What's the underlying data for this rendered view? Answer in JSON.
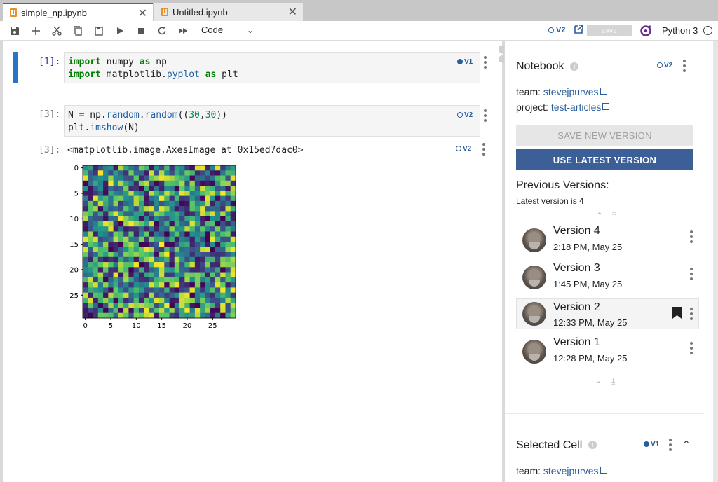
{
  "tabs": [
    {
      "label": "simple_np.ipynb",
      "active": true
    },
    {
      "label": "Untitled.ipynb",
      "active": false
    }
  ],
  "toolbar": {
    "cell_type": "Code",
    "version_tag": "V2",
    "save_label": "SAVE",
    "kernel_name": "Python 3"
  },
  "cells": [
    {
      "prompt": "[1]:",
      "version": "V1",
      "lines": [
        "import numpy as np",
        "import matplotlib.pyplot as plt"
      ]
    },
    {
      "prompt": "[3]:",
      "version": "V2",
      "lines": [
        "N = np.random.random((30,30))",
        "plt.imshow(N)"
      ]
    }
  ],
  "output": {
    "prompt": "[3]:",
    "version": "V2",
    "text": "<matplotlib.image.AxesImage at 0x15ed7dac0>"
  },
  "chart_data": {
    "type": "heatmap",
    "title": "",
    "rows": 30,
    "cols": 30,
    "colormap": "viridis",
    "xticks": [
      "0",
      "5",
      "10",
      "15",
      "20",
      "25"
    ],
    "yticks": [
      "0",
      "5",
      "10",
      "15",
      "20",
      "25"
    ],
    "xlim": [
      0,
      29
    ],
    "ylim": [
      0,
      29
    ],
    "values": "random uniform [0,1)"
  },
  "panel": {
    "notebook_title": "Notebook",
    "notebook_version": "V2",
    "team_label": "team:",
    "team_value": "stevejpurves",
    "project_label": "project:",
    "project_value": "test-articles",
    "save_new_version": "SAVE NEW VERSION",
    "use_latest_version": "USE LATEST VERSION",
    "previous_versions_title": "Previous Versions:",
    "latest_version_text": "Latest version is 4",
    "versions": [
      {
        "name": "Version 4",
        "time": "2:18 PM, May 25",
        "selected": false
      },
      {
        "name": "Version 3",
        "time": "1:45 PM, May 25",
        "selected": false
      },
      {
        "name": "Version 2",
        "time": "12:33 PM, May 25",
        "selected": true
      },
      {
        "name": "Version 1",
        "time": "12:28 PM, May 25",
        "selected": false
      }
    ],
    "selected_cell_title": "Selected Cell",
    "selected_cell_version": "V1",
    "selected_team_label": "team:",
    "selected_team_value": "stevejpurves"
  }
}
